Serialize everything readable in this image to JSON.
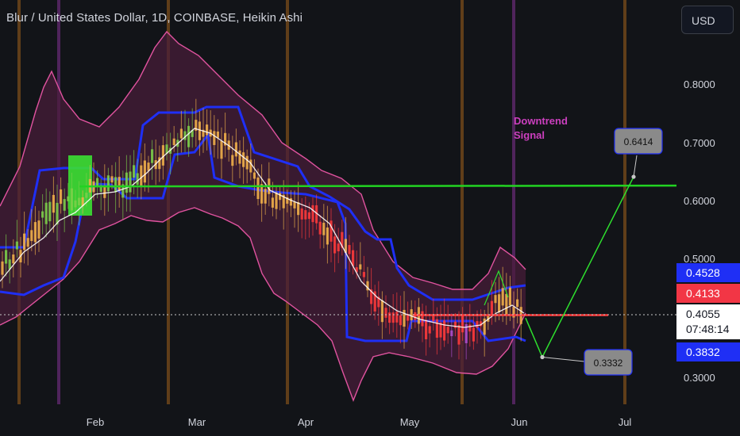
{
  "header": {
    "title": "Blur / United States Dollar, 1D, COINBASE, Heikin Ashi",
    "currency_button": "USD"
  },
  "colors": {
    "background": "#121418",
    "band_fill": "#4a1d3a",
    "band_line": "#e0539f",
    "blue_channel": "#1f2ff5",
    "midline": "#ffffff",
    "green_level": "#22d322",
    "red_level": "#ff3b3b",
    "projection": "#2ee02e",
    "up_candle": "#7ccf4a",
    "down_candle": "#ff3b3b",
    "mixed_candle": "#f2b24a",
    "vertical_orange": "#a0601c",
    "vertical_purple": "#7a2f8a",
    "signal_text": "#cc3fbf"
  },
  "chart_data": {
    "type": "line",
    "x_axis": {
      "ticks": [
        "Feb",
        "Mar",
        "Apr",
        "May",
        "Jun",
        "Jul"
      ]
    },
    "y_axis": {
      "ticks": [
        "0.8000",
        "0.7000",
        "0.6000",
        "0.5000",
        "0.3000"
      ],
      "range": [
        0.26,
        0.92
      ],
      "scale": "linear",
      "position": "right"
    },
    "price_labels": [
      {
        "value": "0.4528",
        "color": "#1f2ff5"
      },
      {
        "value": "0.4133",
        "color": "#f23645"
      },
      {
        "value": "0.4055",
        "color": "#ffffff",
        "countdown": "07:48:14"
      },
      {
        "value": "0.3832",
        "color": "#1f2ff5"
      }
    ],
    "annotations": [
      {
        "text": "Downtrend",
        "line2": "Signal"
      }
    ],
    "projection_callouts": [
      {
        "label": "0.6414",
        "price": 0.6414
      },
      {
        "label": "0.3332",
        "price": 0.3332
      }
    ],
    "levels": [
      {
        "name": "green horizontal level",
        "price": 0.625,
        "color": "#22d322"
      },
      {
        "name": "red horizontal level",
        "price": 0.405,
        "color": "#ff3b3b"
      }
    ],
    "series": [
      {
        "role": "midline",
        "x": [
          "Jan 10",
          "Jan 20",
          "Jan 27",
          "Feb 5",
          "Feb 15",
          "Feb 25",
          "Mar 5",
          "Mar 15",
          "Mar 25",
          "Apr 5",
          "Apr 15",
          "Apr 25",
          "May 5",
          "May 15",
          "May 25",
          "Jun 1",
          "Jun 5"
        ],
        "values": [
          0.44,
          0.5,
          0.56,
          0.6,
          0.62,
          0.66,
          0.72,
          0.68,
          0.63,
          0.58,
          0.52,
          0.44,
          0.42,
          0.4,
          0.395,
          0.42,
          0.4
        ]
      },
      {
        "role": "upper band",
        "values": [
          0.55,
          0.64,
          0.8,
          0.68,
          0.73,
          0.87,
          0.82,
          0.75,
          0.7,
          0.64,
          0.58,
          0.49,
          0.45,
          0.44,
          0.44,
          0.48,
          0.46
        ]
      },
      {
        "role": "lower band",
        "values": [
          0.37,
          0.4,
          0.36,
          0.5,
          0.53,
          0.54,
          0.56,
          0.46,
          0.4,
          0.4,
          0.32,
          0.3,
          0.34,
          0.32,
          0.32,
          0.36,
          0.37
        ]
      },
      {
        "role": "projection",
        "x": [
          "Jun 5",
          "Jun 10",
          "Jun 30"
        ],
        "values": [
          0.4,
          0.3332,
          0.6414
        ]
      }
    ]
  }
}
